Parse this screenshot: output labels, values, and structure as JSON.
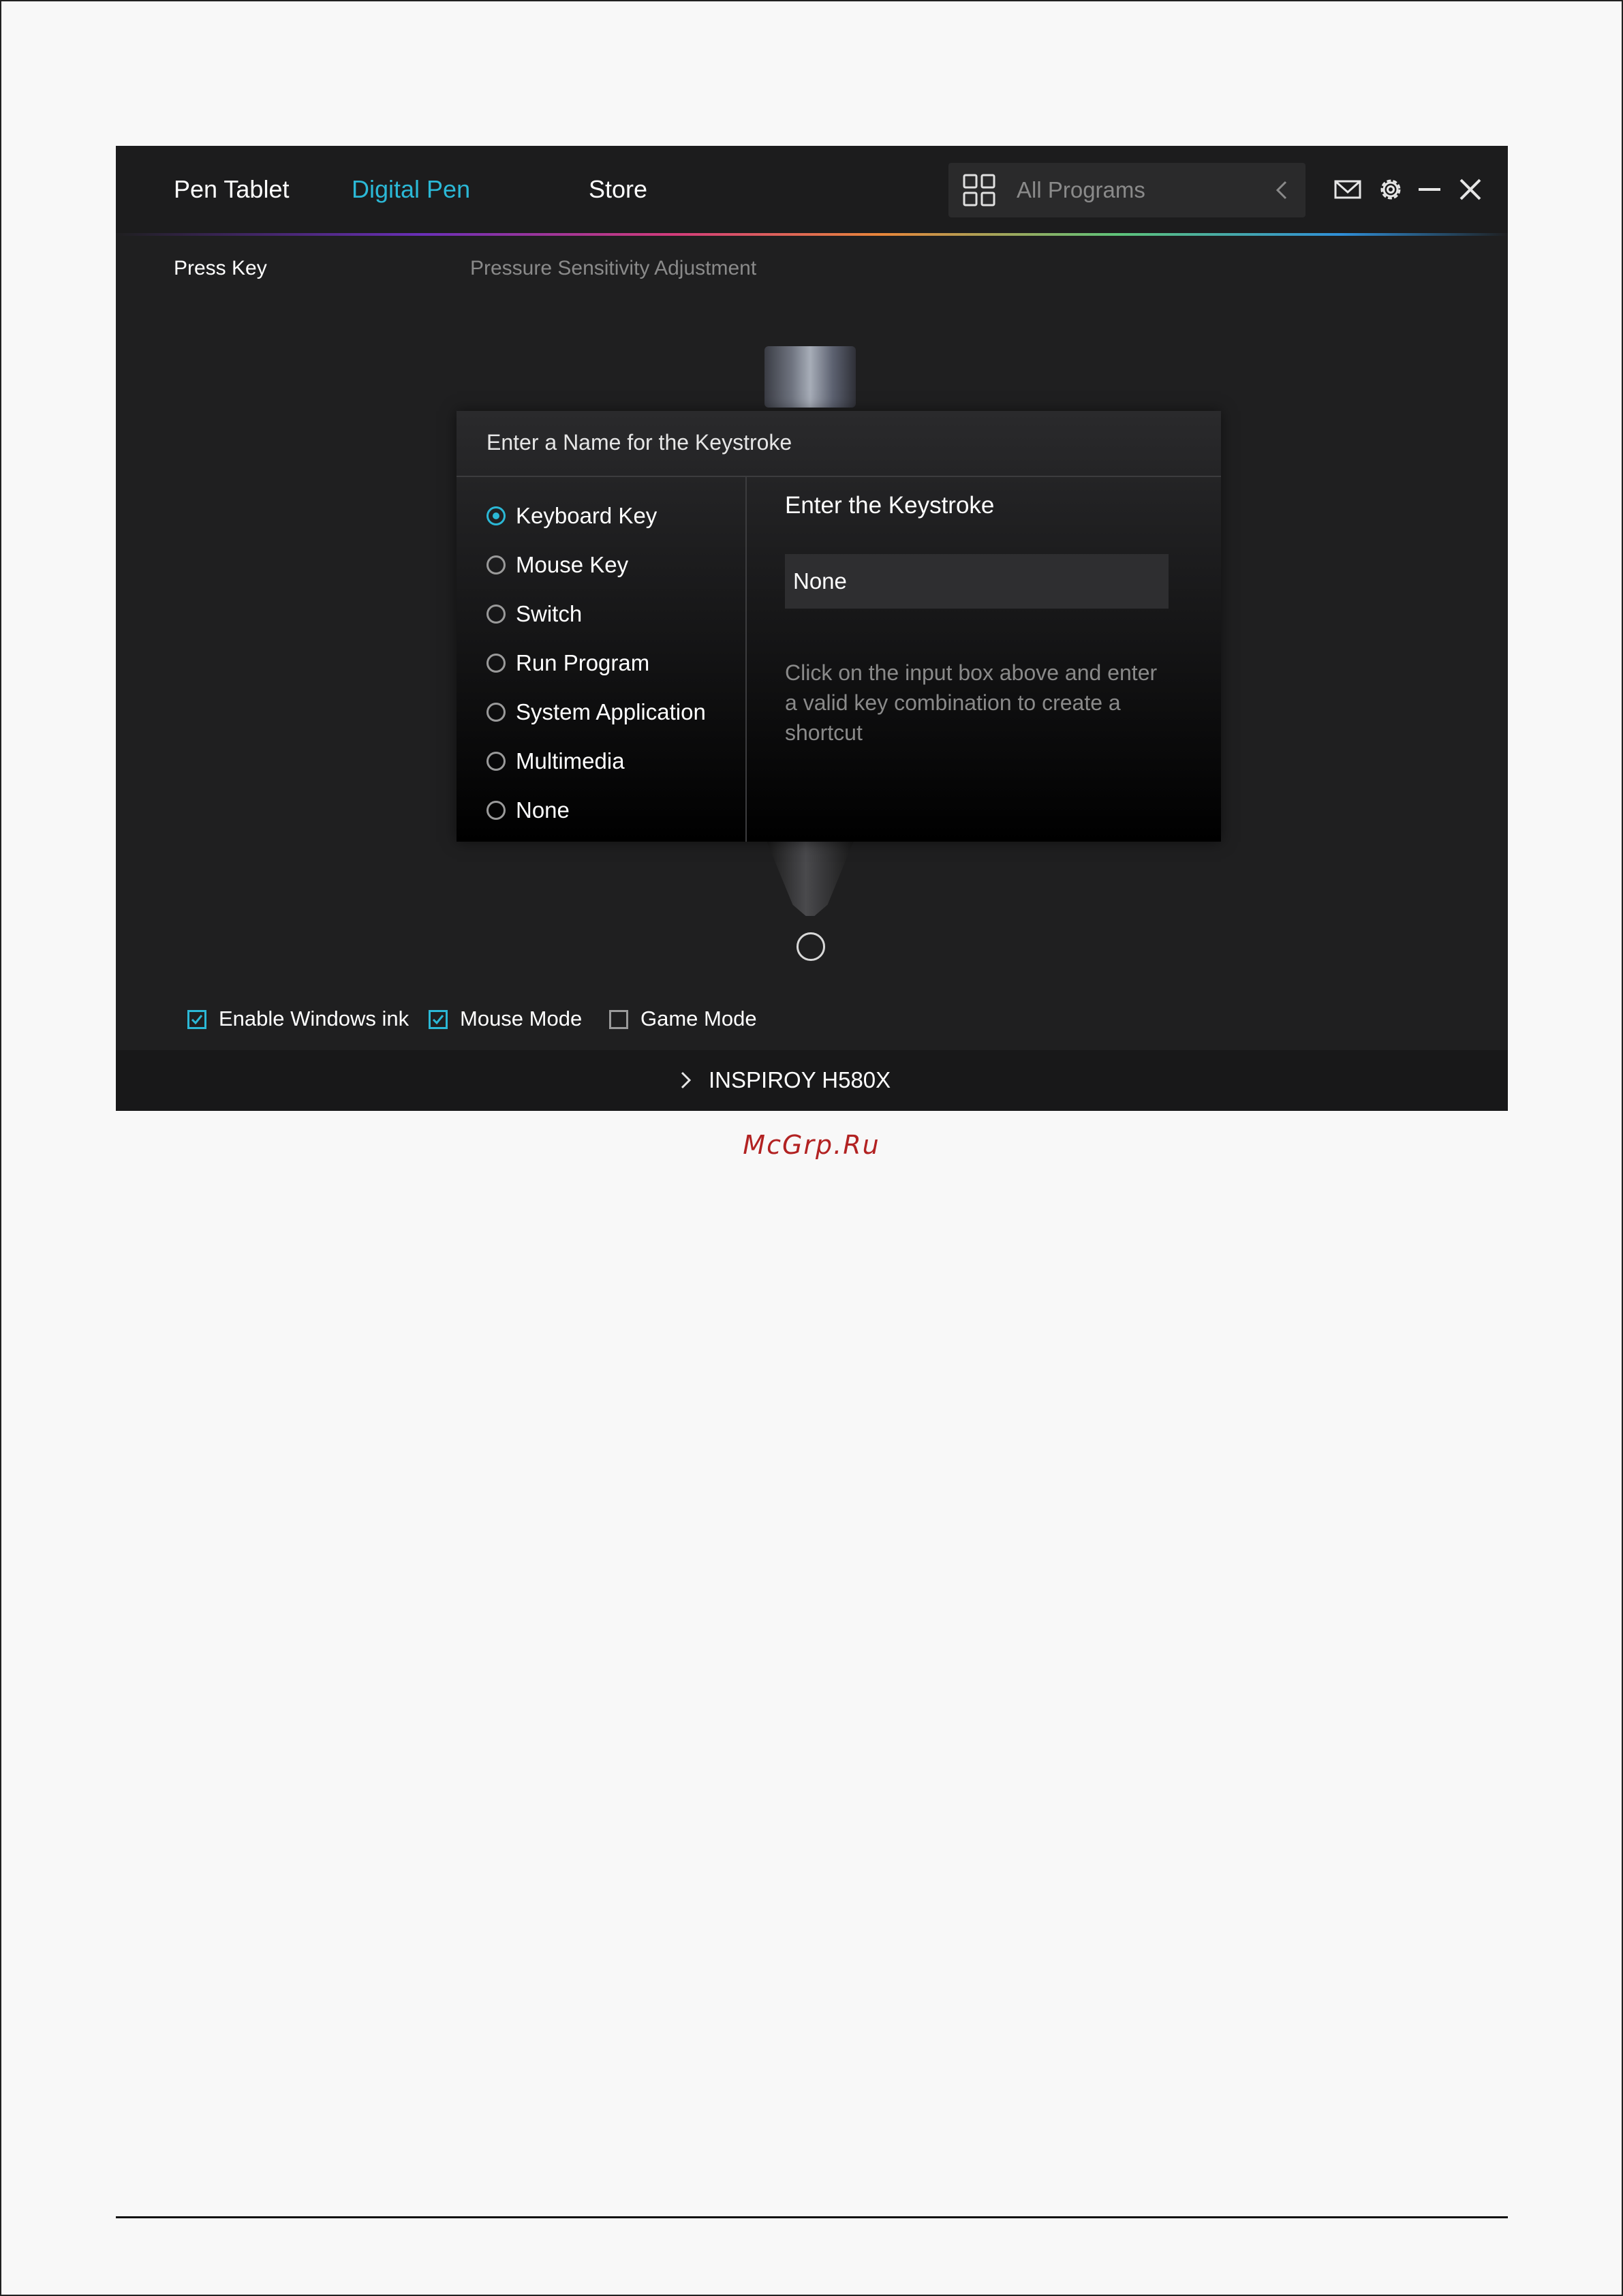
{
  "header": {
    "tabs": [
      {
        "label": "Pen Tablet",
        "active": false
      },
      {
        "label": "Digital Pen",
        "active": true
      },
      {
        "label": "Store",
        "active": false
      }
    ],
    "program_selector": {
      "placeholder": "All Programs",
      "icon": "grid-icon",
      "arrow_icon": "chevron-left-icon"
    },
    "window_icons": [
      "mail-icon",
      "gear-icon",
      "minimize-icon",
      "close-icon"
    ]
  },
  "subtabs": [
    {
      "label": "Press Key",
      "active": true
    },
    {
      "label": "Pressure Sensitivity Adjustment",
      "active": false
    }
  ],
  "dialog": {
    "title": "Enter a Name for the Keystroke",
    "options": [
      {
        "label": "Keyboard Key",
        "selected": true
      },
      {
        "label": "Mouse Key",
        "selected": false
      },
      {
        "label": "Switch",
        "selected": false
      },
      {
        "label": "Run Program",
        "selected": false
      },
      {
        "label": "System Application",
        "selected": false
      },
      {
        "label": "Multimedia",
        "selected": false
      },
      {
        "label": "None",
        "selected": false
      }
    ],
    "keystroke_title": "Enter the Keystroke",
    "keystroke_value": "None",
    "hint": "Click on the input box above and enter a valid key combination to create a shortcut"
  },
  "options": [
    {
      "label": "Enable Windows ink",
      "checked": true
    },
    {
      "label": "Mouse Mode",
      "checked": true
    },
    {
      "label": "Game Mode",
      "checked": false
    }
  ],
  "footer": {
    "device": "INSPIROY H580X"
  },
  "watermark": "McGrp.Ru",
  "colors": {
    "accent": "#2bb8d6",
    "background": "#1f1f20",
    "watermark": "#b22222"
  }
}
